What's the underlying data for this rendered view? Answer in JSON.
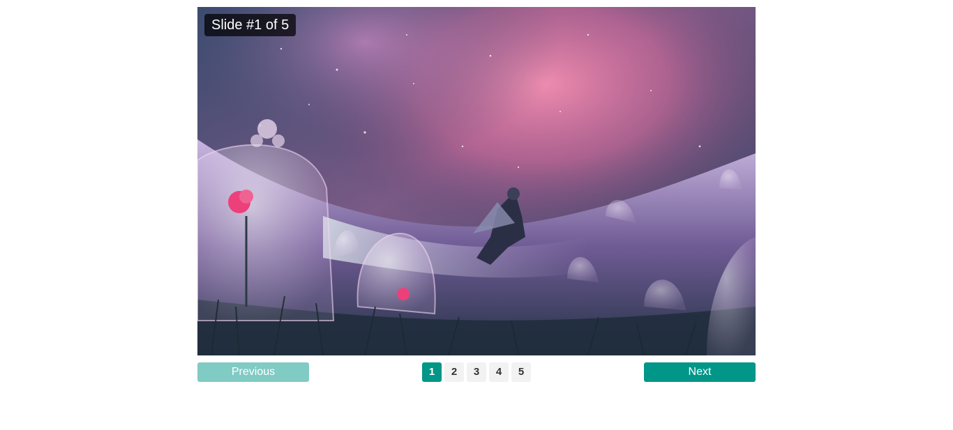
{
  "slider": {
    "caption": "Slide #1 of 5",
    "current_slide": 1,
    "total_slides": 5,
    "image_description_icon": "fantasy-rose-bell-jar-illustration"
  },
  "controls": {
    "previous_label": "Previous",
    "next_label": "Next",
    "pages": [
      "1",
      "2",
      "3",
      "4",
      "5"
    ],
    "active_page": "1"
  },
  "colors": {
    "accent": "#009688",
    "accent_disabled": "#80cbc4",
    "page_bg": "#f2f2f2"
  }
}
